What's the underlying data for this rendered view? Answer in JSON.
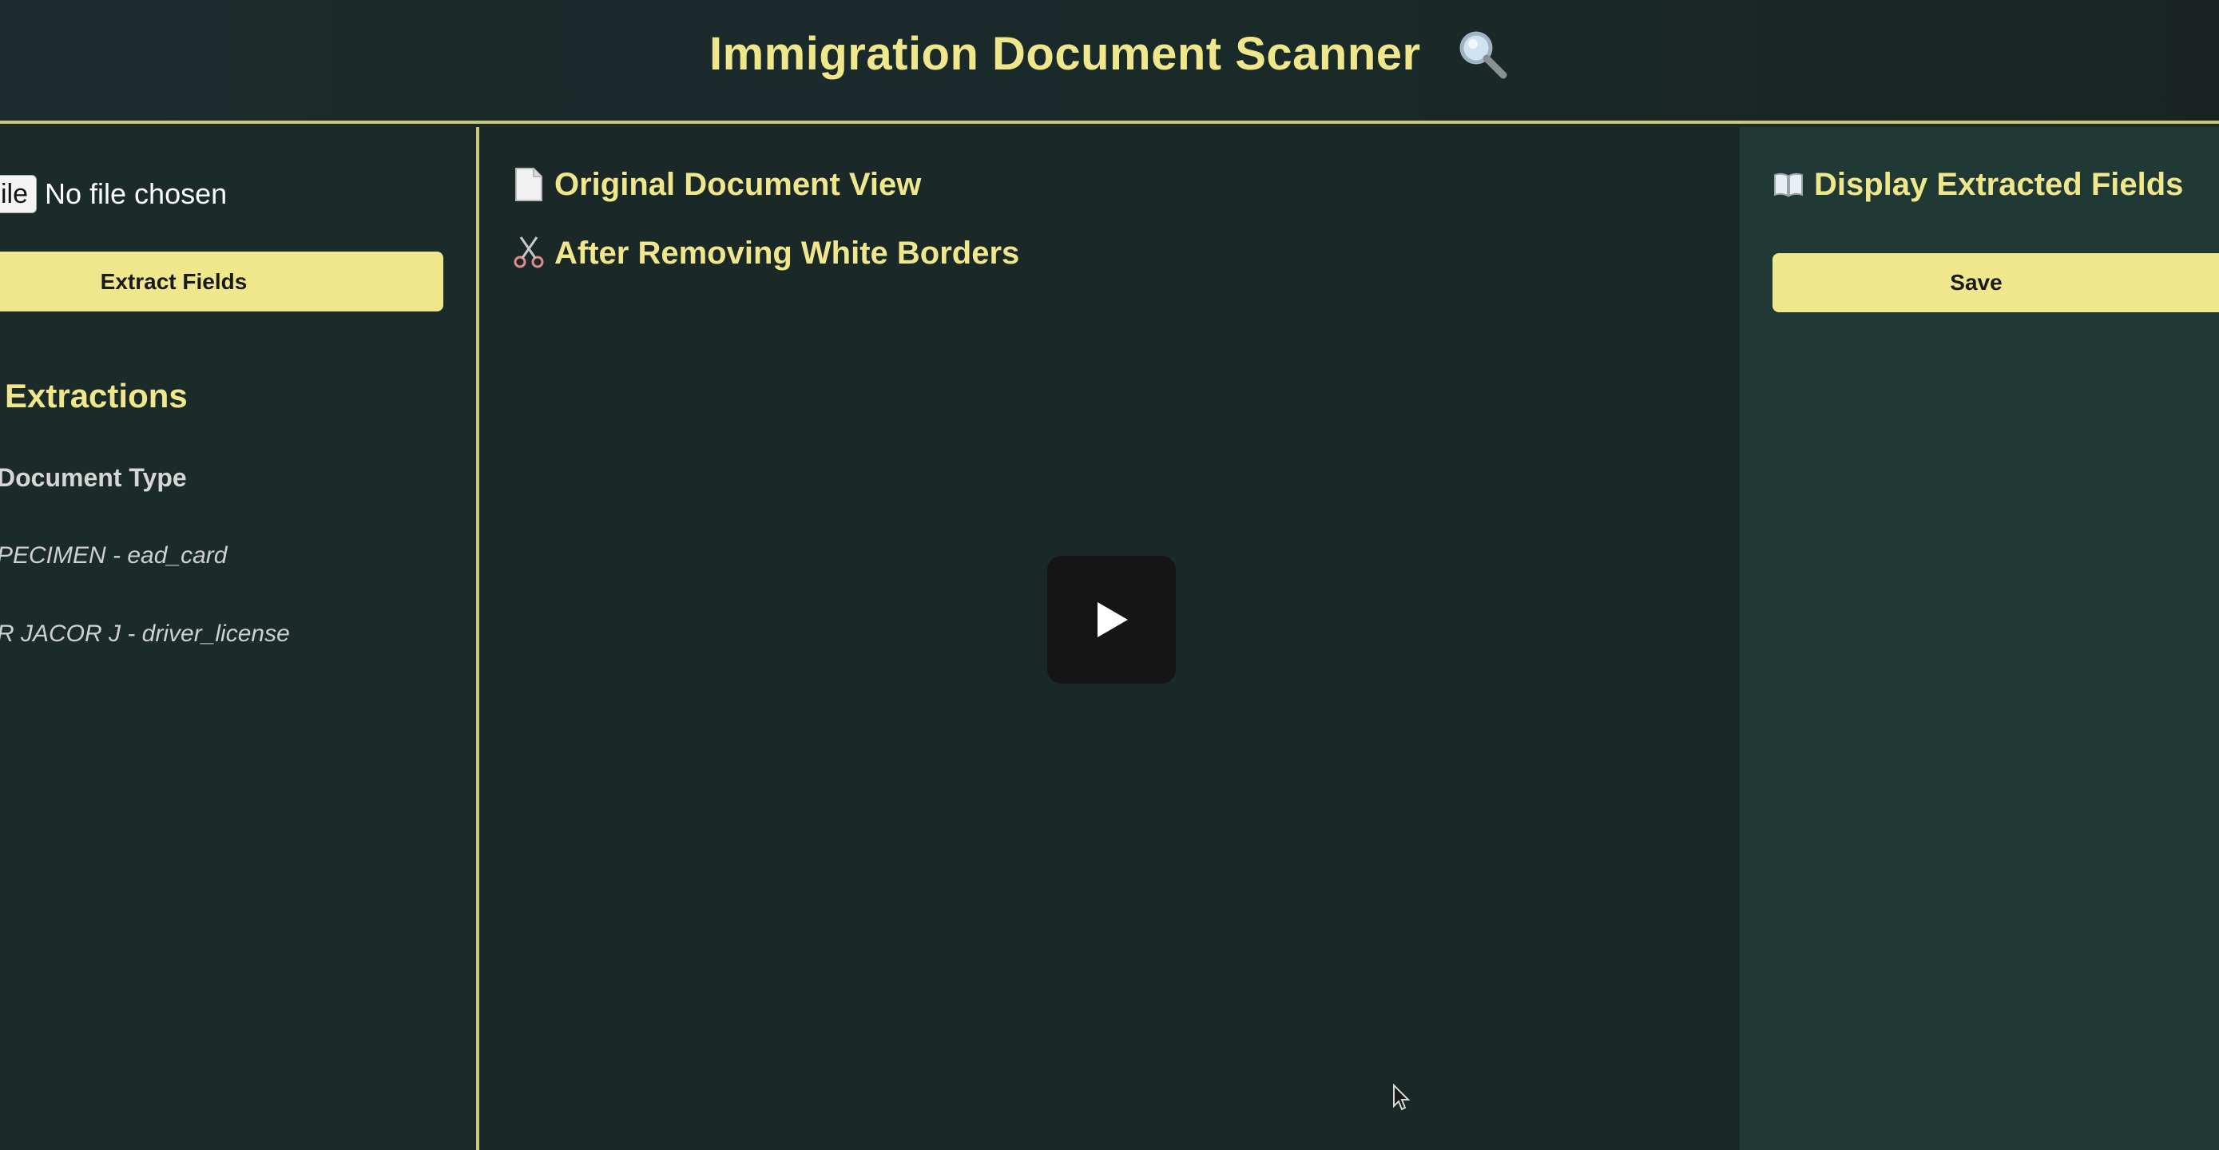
{
  "header": {
    "title": "Immigration Document Scanner",
    "icon": "magnifying-glass-icon"
  },
  "left_panel": {
    "file_input": {
      "button_label": "ile",
      "status": "No file chosen"
    },
    "extract_button_label": "Extract Fields",
    "extractions_title": "Extractions",
    "column_label": "Document Type",
    "items": [
      {
        "label": "PECIMEN - ead_card"
      },
      {
        "label": "R JACOR J - driver_license"
      }
    ]
  },
  "center_panel": {
    "original_view_label": "Original Document View",
    "original_view_icon": "document-icon",
    "after_removing_label": "After Removing White Borders",
    "after_removing_icon": "scissors-icon",
    "play_icon": "play-icon"
  },
  "right_panel": {
    "title": "Display Extracted Fields",
    "title_icon": "open-book-icon",
    "save_button_label": "Save"
  },
  "colors": {
    "accent": "#f0e68c",
    "background": "#1b2a29",
    "right_panel_background": "#213935",
    "divider": "#c9c77a"
  }
}
